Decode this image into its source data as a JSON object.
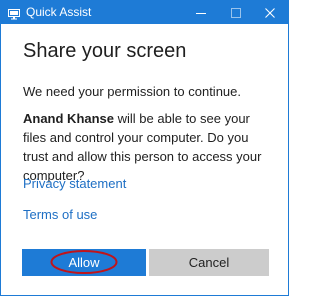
{
  "window": {
    "title": "Quick Assist",
    "accent_color": "#1e7bd6",
    "icons": {
      "app": "quick-assist-monitor-icon",
      "minimize": "minimize-icon",
      "maximize": "maximize-icon",
      "close": "close-icon"
    }
  },
  "content": {
    "heading": "Share your screen",
    "permission_text": "We need your permission to continue.",
    "requester_name": "Anand Khanse",
    "request_text": "will be able to see your files and control your computer. Do you trust and allow this person to access your computer?",
    "links": {
      "privacy": "Privacy statement",
      "terms": "Terms of use"
    },
    "link_color": "#1e6fc4"
  },
  "buttons": {
    "allow": "Allow",
    "cancel": "Cancel",
    "allow_color": "#1e7bd6",
    "cancel_color": "#cccccc"
  },
  "annotation": {
    "type": "red-ellipse-highlight",
    "color": "#c0141a"
  }
}
